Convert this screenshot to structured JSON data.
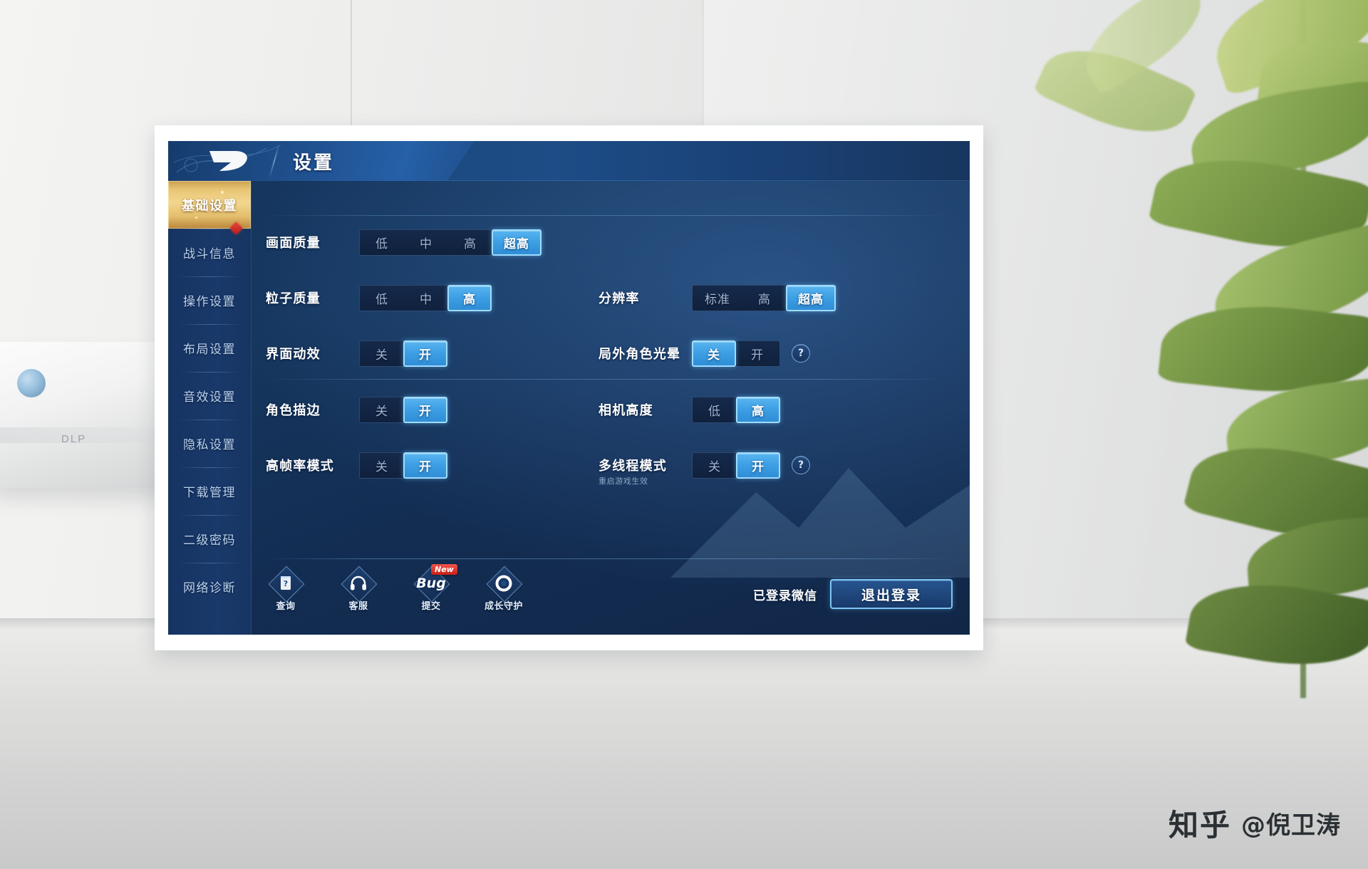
{
  "header": {
    "title": "设置",
    "logo_icon": "game-logo-icon"
  },
  "sidebar": {
    "items": [
      {
        "label": "基础设置",
        "active": true,
        "badge": false
      },
      {
        "label": "战斗信息",
        "active": false,
        "badge": true
      },
      {
        "label": "操作设置",
        "active": false,
        "badge": false
      },
      {
        "label": "布局设置",
        "active": false,
        "badge": false
      },
      {
        "label": "音效设置",
        "active": false,
        "badge": false
      },
      {
        "label": "隐私设置",
        "active": false,
        "badge": false
      },
      {
        "label": "下载管理",
        "active": false,
        "badge": false
      },
      {
        "label": "二级密码",
        "active": false,
        "badge": false
      },
      {
        "label": "网络诊断",
        "active": false,
        "badge": false
      }
    ]
  },
  "settings": {
    "rows": [
      {
        "left": {
          "label": "画面质量",
          "sub": "",
          "options": [
            "低",
            "中",
            "高",
            "超高"
          ],
          "selected": "超高",
          "help": false
        },
        "right": null
      },
      {
        "left": {
          "label": "粒子质量",
          "sub": "",
          "options": [
            "低",
            "中",
            "高"
          ],
          "selected": "高",
          "help": false
        },
        "right": {
          "label": "分辨率",
          "sub": "",
          "options": [
            "标准",
            "高",
            "超高"
          ],
          "selected": "超高",
          "help": false
        }
      },
      {
        "left": {
          "label": "界面动效",
          "sub": "",
          "options": [
            "关",
            "开"
          ],
          "selected": "开",
          "help": false
        },
        "right": {
          "label": "局外角色光晕",
          "sub": "",
          "options": [
            "关",
            "开"
          ],
          "selected": "关",
          "help": true
        }
      },
      {
        "left": {
          "label": "角色描边",
          "sub": "",
          "options": [
            "关",
            "开"
          ],
          "selected": "开",
          "help": false
        },
        "right": {
          "label": "相机高度",
          "sub": "",
          "options": [
            "低",
            "高"
          ],
          "selected": "高",
          "help": false
        }
      },
      {
        "left": {
          "label": "高帧率模式",
          "sub": "",
          "options": [
            "关",
            "开"
          ],
          "selected": "开",
          "help": false
        },
        "right": {
          "label": "多线程模式",
          "sub": "重启游戏生效",
          "options": [
            "关",
            "开"
          ],
          "selected": "开",
          "help": true
        }
      }
    ],
    "help_symbol": "?"
  },
  "bottom_bar": {
    "tools": [
      {
        "caption": "查询",
        "icon": "question-document-icon",
        "badge": ""
      },
      {
        "caption": "客服",
        "icon": "headset-icon",
        "badge": ""
      },
      {
        "caption": "提交",
        "icon": "bug-icon",
        "badge": "New",
        "glyph_text": "Bug"
      },
      {
        "caption": "成长守护",
        "icon": "guardian-ring-icon",
        "badge": ""
      }
    ],
    "login_status": "已登录微信",
    "logout_label": "退出登录"
  },
  "watermark": {
    "site": "知乎",
    "user": "@倪卫涛"
  },
  "colors": {
    "accent_selected": "#3d9fe4",
    "accent_border": "#9fdcff",
    "sidebar_active_gold": "#e8c574",
    "panel_bg": "#15355e",
    "badge_red": "#c71f18"
  }
}
